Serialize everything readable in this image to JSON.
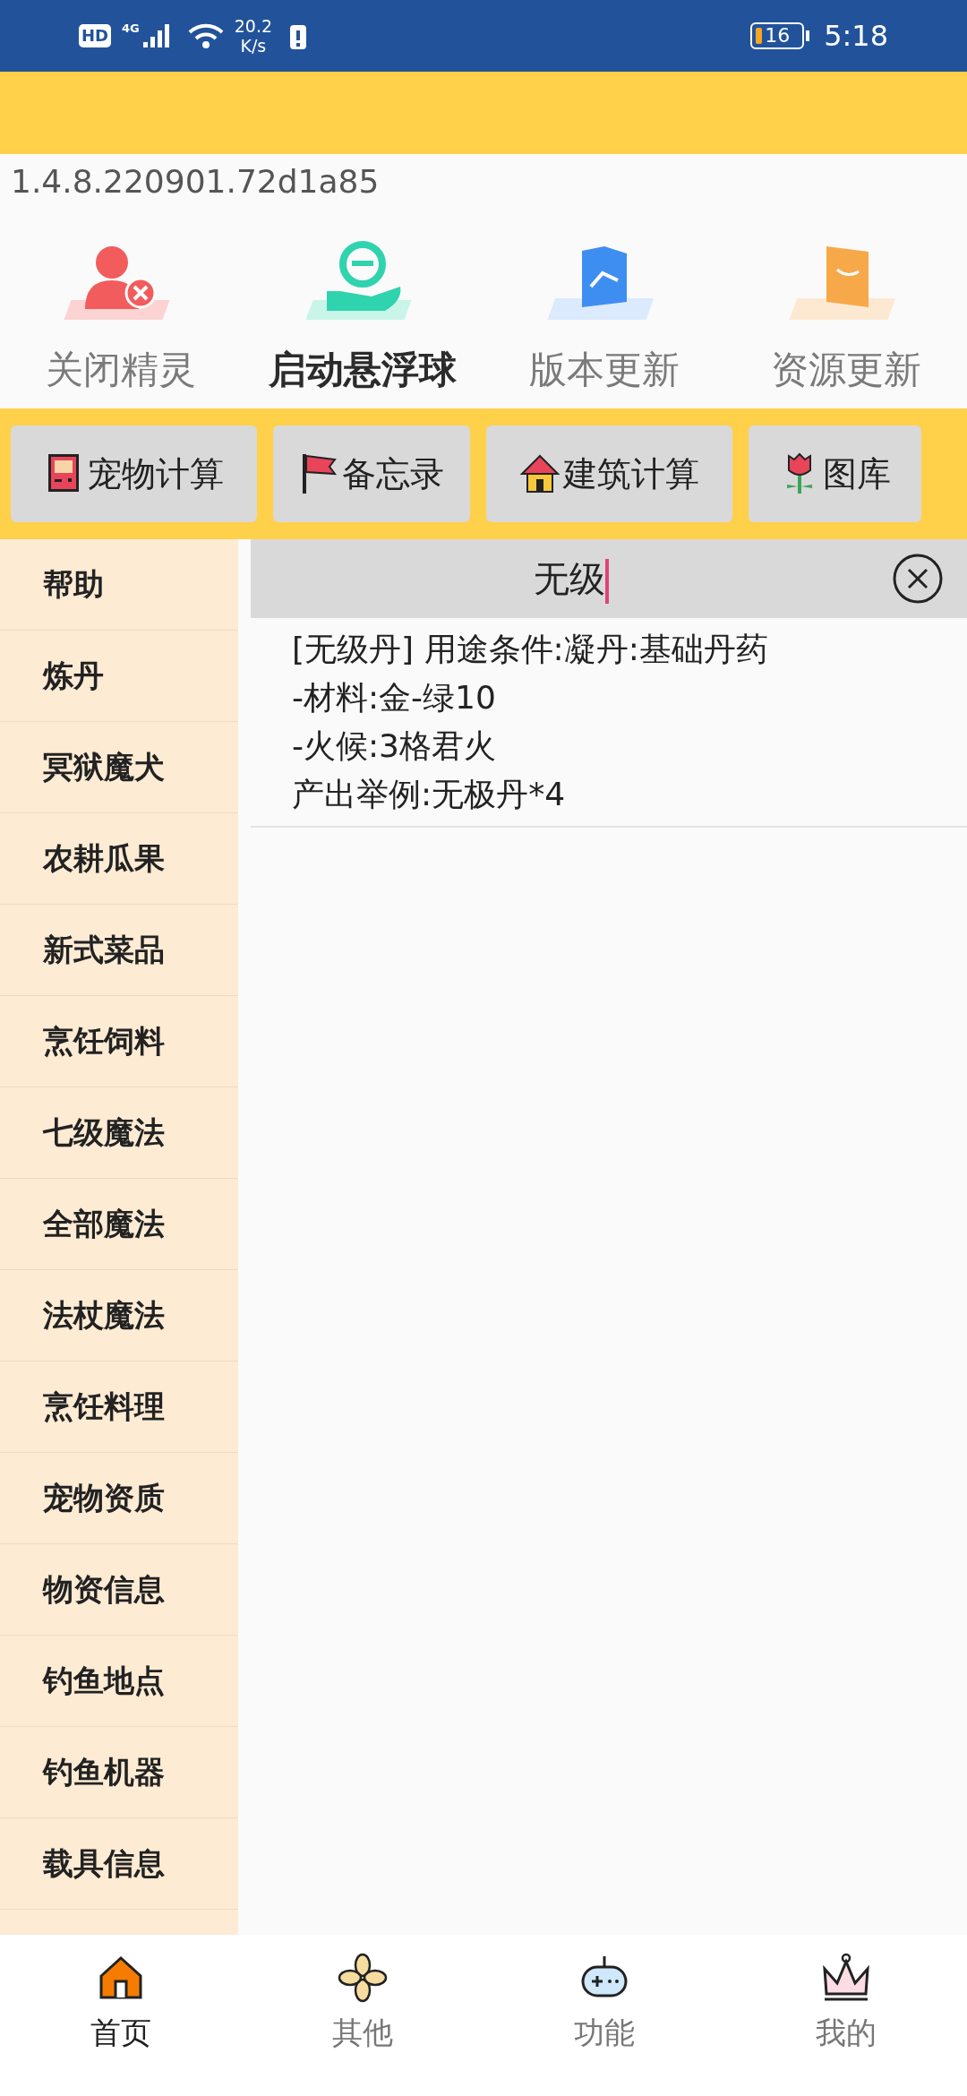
{
  "status_bar": {
    "hd": "HD",
    "network": "4G",
    "speed_value": "20.2",
    "speed_unit": "K/s",
    "battery": "16",
    "time": "5:18"
  },
  "version": "1.4.8.220901.72d1a85",
  "actions": [
    {
      "label": "关闭精灵",
      "kind": "person",
      "active": false
    },
    {
      "label": "启动悬浮球",
      "kind": "hand",
      "active": true
    },
    {
      "label": "版本更新",
      "kind": "folder",
      "active": false
    },
    {
      "label": "资源更新",
      "kind": "box",
      "active": false
    }
  ],
  "tools": [
    {
      "label": "宠物计算",
      "kind": "gameboy"
    },
    {
      "label": "备忘录",
      "kind": "flag"
    },
    {
      "label": "建筑计算",
      "kind": "house"
    },
    {
      "label": "图库",
      "kind": "flower"
    }
  ],
  "sidebar": {
    "items": [
      "帮助",
      "炼丹",
      "冥狱魔犬",
      "农耕瓜果",
      "新式菜品",
      "烹饪饲料",
      "七级魔法",
      "全部魔法",
      "法杖魔法",
      "烹饪料理",
      "宠物资质",
      "物资信息",
      "钓鱼地点",
      "钓鱼机器",
      "载具信息"
    ]
  },
  "search": {
    "value": "无级"
  },
  "results": [
    {
      "lines": [
        "[无级丹] 用途条件:凝丹:基础丹药",
        "-材料:金-绿10",
        "-火候:3格君火",
        "产出举例:无极丹*4"
      ]
    }
  ],
  "bottom_nav": [
    {
      "label": "首页",
      "kind": "home",
      "selected": true
    },
    {
      "label": "其他",
      "kind": "pinwheel",
      "selected": false
    },
    {
      "label": "功能",
      "kind": "gamepad",
      "selected": false
    },
    {
      "label": "我的",
      "kind": "crown",
      "selected": false
    }
  ]
}
